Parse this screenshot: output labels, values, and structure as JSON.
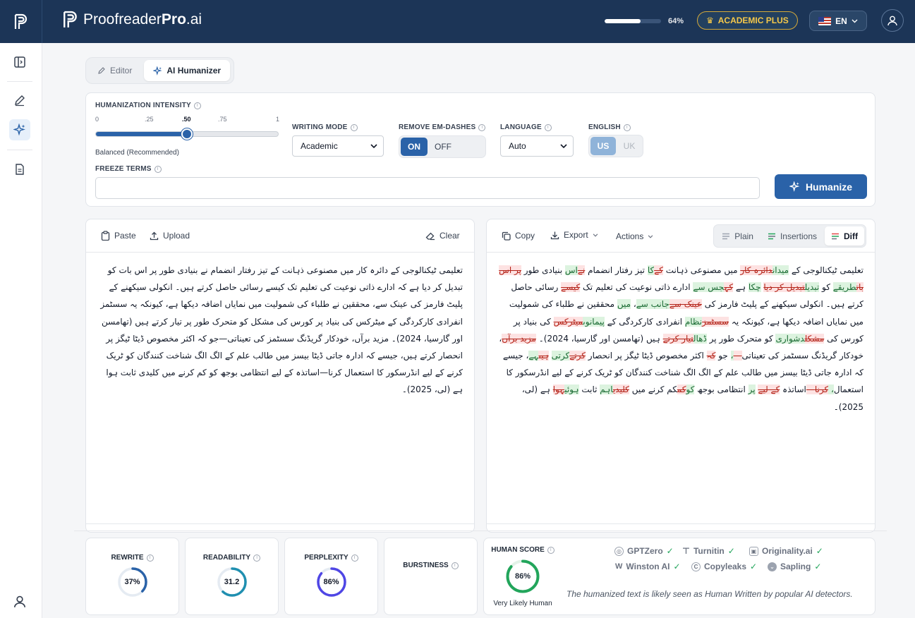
{
  "header": {
    "brand_light": "Proofreader",
    "brand_bold": "Pro",
    "brand_suffix": ".ai",
    "usage_percent": 64,
    "usage_label": "64%",
    "plan_label": "ACADEMIC PLUS",
    "language_label": "EN"
  },
  "mode_tabs": [
    {
      "label": "Editor"
    },
    {
      "label": "AI Humanizer"
    }
  ],
  "settings": {
    "intensity_label": "HUMANIZATION INTENSITY",
    "intensity_ticks": [
      "0",
      ".25",
      ".50",
      ".75",
      "1"
    ],
    "intensity_value": 0.5,
    "intensity_note": "Balanced (Recommended)",
    "writing_mode_label": "WRITING MODE",
    "writing_mode_value": "Academic",
    "em_dash_label": "REMOVE EM-DASHES",
    "em_dash_on": "ON",
    "em_dash_off": "OFF",
    "language_label": "LANGUAGE",
    "language_value": "Auto",
    "english_label": "ENGLISH",
    "english_us": "US",
    "english_uk": "UK",
    "freeze_label": "FREEZE TERMS",
    "freeze_value": "",
    "humanize_label": "Humanize"
  },
  "input_panel": {
    "paste_label": "Paste",
    "upload_label": "Upload",
    "clear_label": "Clear",
    "text": "تعلیمی ٹیکنالوجی کے دائرہ کار میں مصنوعی ذہانت کے تیز رفتار انضمام نے بنیادی طور پر اس بات کو تبدیل کر دیا ہے کہ ادارے ذاتی نوعیت کی تعلیم تک کیسے رسائی حاصل کرتے ہیں۔ انکولی سیکھنے کے پلیٹ فارمز کی عینک سے، محققین نے طلباء کی شمولیت میں نمایاں اضافہ دیکھا ہے، کیونکہ یہ سسٹمز انفرادی کارکردگی کے میٹرکس کی بنیاد پر کورس کی مشکل کو متحرک طور پر تیار کرتے ہیں (تھامسن اور گارسیا، 2024)۔ مزید برآں، خودکار گریڈنگ سسٹمز کی تعیناتی—جو کہ اکثر مخصوص ڈیٹا ٹیگز پر انحصار کرتے ہیں، جیسے کہ ادارہ جاتی ڈیٹا بیسز میں طالب علم کے الگ الگ شناخت کنندگان کو ٹریک کرنے کے لیے انڈرسکور کا استعمال کرنا—اساتذہ کے لیے انتظامی بوجھ کو کم کرنے میں کلیدی ثابت ہوا ہے (لی، 2025)۔"
  },
  "output_panel": {
    "copy_label": "Copy",
    "export_label": "Export",
    "actions_label": "Actions",
    "view_plain": "Plain",
    "view_insertions": "Insertions",
    "view_diff": "Diff",
    "diff": [
      {
        "t": "n",
        "s": "تعلیمی ٹیکنالوجی کے "
      },
      {
        "t": "i",
        "s": "میدان"
      },
      {
        "t": "d",
        "s": "دائرہ کار"
      },
      {
        "t": "n",
        "s": " میں مصنوعی ذہانت "
      },
      {
        "t": "d",
        "s": "کے"
      },
      {
        "t": "i",
        "s": "کا"
      },
      {
        "t": "n",
        "s": " تیز رفتار انضمام "
      },
      {
        "t": "d",
        "s": "نے"
      },
      {
        "t": "i",
        "s": "اس"
      },
      {
        "t": "n",
        "s": " بنیادی طور "
      },
      {
        "t": "d",
        "s": "پر اس بات"
      },
      {
        "t": "i",
        "s": "طریقے"
      },
      {
        "t": "n",
        "s": " کو "
      },
      {
        "t": "i",
        "s": "تبدیل"
      },
      {
        "t": "d",
        "s": "تبدیل کر دیا"
      },
      {
        "t": "n",
        "s": " "
      },
      {
        "t": "i",
        "s": "چکا"
      },
      {
        "t": "n",
        "s": " ہے "
      },
      {
        "t": "d",
        "s": "کہ"
      },
      {
        "t": "i",
        "s": "جس سے"
      },
      {
        "t": "n",
        "s": " ادارے ذاتی نوعیت کی تعلیم تک "
      },
      {
        "t": "d",
        "s": "کیسے"
      },
      {
        "t": "n",
        "s": " رسائی حاصل کرتے ہیں۔ انکولی سیکھنے کے پلیٹ فارمز کی "
      },
      {
        "t": "d",
        "s": "عینک سے"
      },
      {
        "t": "i",
        "s": "جانب سے"
      },
      {
        "t": "n",
        "s": "، "
      },
      {
        "t": "i",
        "s": "میں"
      },
      {
        "t": "n",
        "s": " محققین نے طلباء کی شمولیت میں نمایاں اضافہ دیکھا ہے، کیونکہ یہ "
      },
      {
        "t": "d",
        "s": "سسٹمز"
      },
      {
        "t": "i",
        "s": "نظام"
      },
      {
        "t": "n",
        "s": " انفرادی کارکردگی کے "
      },
      {
        "t": "i",
        "s": "پیمانوں"
      },
      {
        "t": "d",
        "s": "میٹرکس"
      },
      {
        "t": "n",
        "s": " کی بنیاد پر کورس کی "
      },
      {
        "t": "d",
        "s": "مشکل"
      },
      {
        "t": "i",
        "s": "دشواری"
      },
      {
        "t": "n",
        "s": " کو متحرک طور پر "
      },
      {
        "t": "i",
        "s": "ڈھال"
      },
      {
        "t": "d",
        "s": "تیار کرتے"
      },
      {
        "t": "n",
        "s": " ہیں (تھامسن اور گارسیا، 2024)۔ "
      },
      {
        "t": "d",
        "s": "مزید برآں"
      },
      {
        "t": "n",
        "s": "، خودکار گریڈنگ سسٹمز کی تعیناتی"
      },
      {
        "t": "d",
        "s": "—"
      },
      {
        "t": "i",
        "s": "،"
      },
      {
        "t": "n",
        "s": " جو "
      },
      {
        "t": "d",
        "s": "کہ"
      },
      {
        "t": "n",
        "s": " اکثر مخصوص ڈیٹا ٹیگز پر انحصار "
      },
      {
        "t": "d",
        "s": "کرتے"
      },
      {
        "t": "i",
        "s": "کرتی"
      },
      {
        "t": "n",
        "s": " "
      },
      {
        "t": "d",
        "s": "ہیں"
      },
      {
        "t": "i",
        "s": "ہے"
      },
      {
        "t": "n",
        "s": "، جیسے کہ ادارہ جاتی ڈیٹا بیسز میں طالب علم کے الگ الگ شناخت کنندگان کو ٹریک کرنے کے لیے انڈرسکور کا استعمال"
      },
      {
        "t": "i",
        "s": "، "
      },
      {
        "t": "d",
        "s": "کرنا"
      },
      {
        "t": "d",
        "s": "—"
      },
      {
        "t": "n",
        "s": "اساتذہ "
      },
      {
        "t": "d",
        "s": "کے لیے"
      },
      {
        "t": "n",
        "s": " "
      },
      {
        "t": "i",
        "s": "پر"
      },
      {
        "t": "n",
        "s": " انتظامی بوجھ "
      },
      {
        "t": "i",
        "s": "کو"
      },
      {
        "t": "d",
        "s": "کم"
      },
      {
        "t": "n",
        "s": "کم کرنے میں "
      },
      {
        "t": "d",
        "s": "کلیدی"
      },
      {
        "t": "i",
        "s": "اہم"
      },
      {
        "t": "n",
        "s": " ثابت "
      },
      {
        "t": "i",
        "s": "ہوئی"
      },
      {
        "t": "d",
        "s": "ہوا"
      },
      {
        "t": "n",
        "s": " ہے (لی، 2025)۔"
      }
    ]
  },
  "metrics": [
    {
      "label": "REWRITE",
      "value": 37,
      "display": "37%",
      "color": "#2a62a8"
    },
    {
      "label": "READABILITY",
      "value": 62,
      "display": "31.2",
      "color": "#1f8fb0"
    },
    {
      "label": "PERPLEXITY",
      "value": 86,
      "display": "86%",
      "color": "#4f46e5"
    },
    {
      "label": "BURSTINESS"
    }
  ],
  "human_score": {
    "label": "HUMAN SCORE",
    "value": 86,
    "display": "86%",
    "verdict": "Very Likely Human",
    "color": "#22a55b"
  },
  "detectors": [
    {
      "name": "GPTZero"
    },
    {
      "name": "Turnitin"
    },
    {
      "name": "Originality.ai"
    },
    {
      "name": "Winston AI"
    },
    {
      "name": "Copyleaks"
    },
    {
      "name": "Sapling"
    }
  ],
  "detector_note": "The humanized text is likely seen as Human Written by popular AI detectors.",
  "colors": {
    "navy": "#1c3557",
    "primary": "#2a62a8",
    "gold": "#f5c84a",
    "success": "#22a55b"
  }
}
